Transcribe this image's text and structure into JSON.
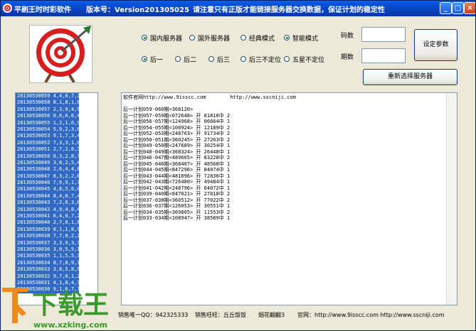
{
  "window": {
    "title_app": "平刷王时时彩软件",
    "title_version": "版本号：Version201305025",
    "title_notice": "请注意只有正版才能链接服务器交换数据，保证计划的稳定性"
  },
  "server_options": [
    {
      "label": "国内服务器",
      "checked": true
    },
    {
      "label": "国外服务器",
      "checked": false
    },
    {
      "label": "经典模式",
      "checked": false
    },
    {
      "label": "智能模式",
      "checked": true
    }
  ],
  "position_options": [
    {
      "label": "后一",
      "checked": true
    },
    {
      "label": "后二",
      "checked": false
    },
    {
      "label": "后三",
      "checked": false
    },
    {
      "label": "后三不定位",
      "checked": false
    },
    {
      "label": "五星不定位",
      "checked": false
    }
  ],
  "fields": {
    "code_label": "码数",
    "code_value": "",
    "period_label": "期数",
    "period_value": ""
  },
  "buttons": {
    "set_params": "设定参数",
    "reselect_server": "重新选择服务器"
  },
  "draw_history": [
    "20130530059 4,4,0,7,3",
    "20130530058 8,1,8,1,0",
    "20130530057 2,3,9,4,9",
    "20130530056 0,6,6,6,4",
    "20130530055 1,2,1,6,9",
    "20130530054 5,9,2,3,6",
    "20130530053 9,1,7,3,4",
    "20130530052 7,3,3,1,0",
    "20130530051 2,7,2,6,3",
    "20130530050 0,3,2,8,7",
    "20130530049 3,0,2,5,4",
    "20130530048 2,6,4,4,8",
    "20130530047 8,3,2,2,8",
    "20130530046 7,9,9,1,7",
    "20130530045 4,8,5,6,0",
    "20130530044 8,4,0,7,4",
    "20130530043 7,2,8,3,6",
    "20130530042 4,9,4,8,4",
    "20130530041 6,4,0,7,2",
    "20130530040 2,7,8,1,8",
    "20130530039 0,1,1,8,9",
    "20130530038 7,7,0,2,2",
    "20130530037 3,3,9,3,7",
    "20130530036 3,0,5,5,1",
    "20130530035 1,1,5,5,3",
    "20130530034 0,7,8,9,1",
    "20130530033 3,8,5,8,9",
    "20130530032 9,7,0,1,2",
    "20130530031 4,1,8,4,7",
    "20130530030 9,1,6,7,7"
  ],
  "output_lines": [
    "软件官网http://www.9isscc.com        http://www.sscniji.com",
    "",
    "后一计划059-060期<368120>",
    "后一计划057-059期<072648> 开 81810中 2",
    "后一计划056-057期<124968> 开 06664中 1",
    "后一计划054-055期<108924> 开 12189中 2",
    "后一计划052-053期<248763> 开 91734中 2",
    "后一计划050-051期<360245> 开 27263中 2",
    "后一计划049-050期<247689> 开 30254中 1",
    "后一计划048-049期<368324> 开 26448中 1",
    "后一计划046-047期<489605> 开 83228中 2",
    "后一计划045-046期<368407> 开 48560中 1",
    "后一计划044-045期<847296> 开 84074中 1",
    "后一计划043-044期<481096> 开 72836中 1",
    "后一计划042-043期<726480> 开 49484中 1",
    "后一计划041-042期<248796> 开 64072中 1",
    "后一计划039-040期<847021> 开 27818中 2",
    "后一计划037-038期<360512> 开 77022中 2",
    "后一计划036-037期<126053> 开 30551中 1",
    "后一计划034-035期<369805> 开 11553中 2",
    "后一计划033-034期<108947> 开 38589中 1"
  ],
  "footer": {
    "qq": "销售唯一QQ：942325333",
    "wangwang": "销售旺旺：丘丘饭饭",
    "yanhua": "烟花翩翩3",
    "site": "官网：http://www.9isscc.com   http://www.sscniji.com"
  },
  "watermark": {
    "logo": "下载王",
    "url": "www.xzking.com"
  }
}
